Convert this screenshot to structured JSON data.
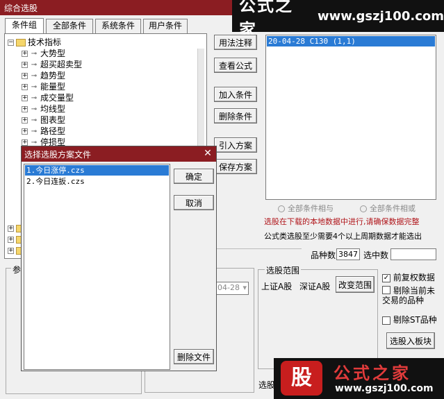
{
  "window": {
    "title": "综合选股"
  },
  "watermark_top": {
    "name": "公式之家",
    "url": "www.gszj100.com"
  },
  "tabs": [
    {
      "label": "条件组"
    },
    {
      "label": "全部条件"
    },
    {
      "label": "系统条件"
    },
    {
      "label": "用户条件"
    }
  ],
  "tree": {
    "root": "技术指标",
    "items": [
      "大势型",
      "超买超卖型",
      "趋势型",
      "能量型",
      "成交量型",
      "均线型",
      "图表型",
      "路径型",
      "停损型"
    ]
  },
  "buttons": {
    "usage": "用法注释",
    "view_formula": "查看公式",
    "add_condition": "加入条件",
    "delete_condition": "删除条件",
    "import_plan": "引入方案",
    "save_plan": "保存方案",
    "change_range": "改变范围",
    "add_to_block": "选股入板块"
  },
  "result_list": {
    "selected": "20-04-28 C130 (1,1)"
  },
  "logic": {
    "and": "全部条件相与",
    "or": "全部条件相或"
  },
  "notes": {
    "local_data": "选股在下载的本地数据中进行,请确保数据完整",
    "formula_need": "公式类选股至少需要4个以上周期数据才能选出"
  },
  "stats": {
    "variety_label": "品种数",
    "variety_value": "3847",
    "selected_label": "选中数",
    "selected_value": ""
  },
  "partial_labels": {
    "params": "参",
    "select_bottom": "选股"
  },
  "date_field": {
    "value": "04-28"
  },
  "range": {
    "title": "选股范围",
    "sh": "上证A股",
    "sz": "深证A股"
  },
  "options": {
    "adjust": "前复权数据",
    "exclude_suspended": "剔除当前未交易的品种",
    "exclude_st": "剔除ST品种"
  },
  "dialog": {
    "title": "选择选股方案文件",
    "files": [
      "1.今日涨停.czs",
      "2.今日连扳.czs"
    ],
    "ok": "确定",
    "cancel": "取消",
    "delete_file": "删除文件"
  },
  "watermark_bottom": {
    "badge": "股",
    "name": "公式之家",
    "url": "www.gszj100.com"
  }
}
